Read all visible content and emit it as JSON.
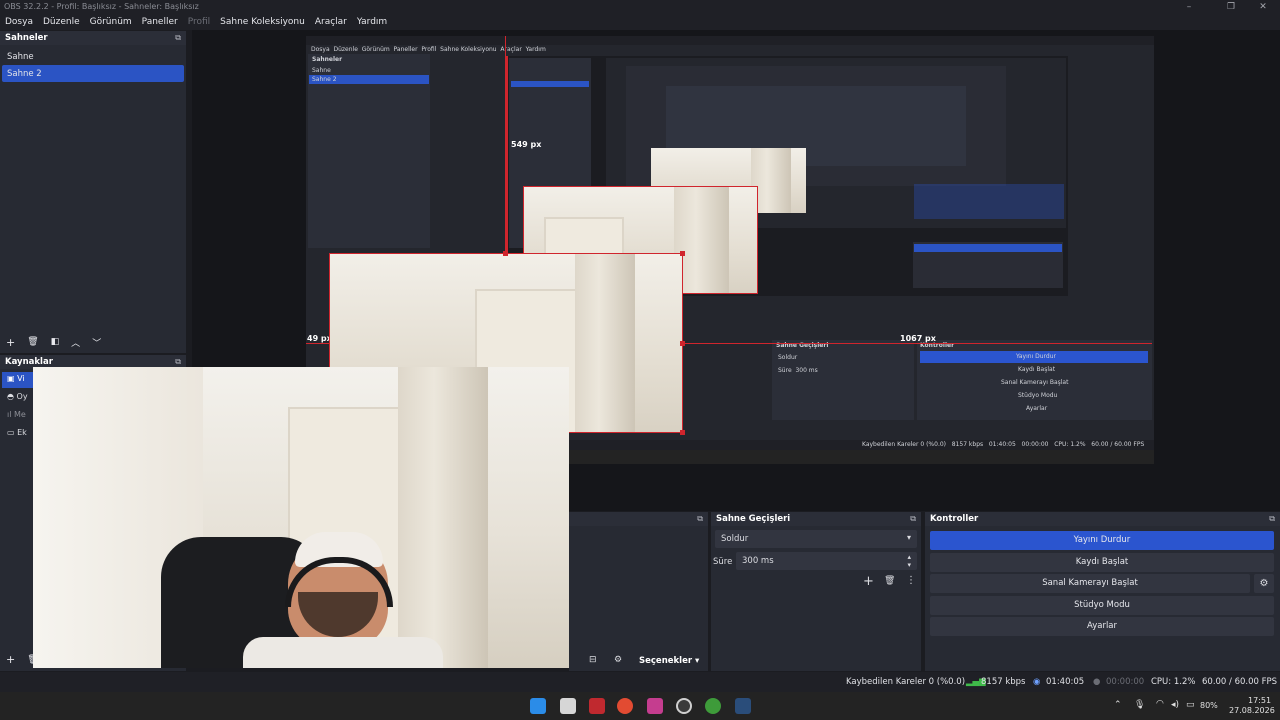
{
  "window": {
    "title": "OBS 32.2.2 - Profil: Başlıksız - Sahneler: Başlıksız"
  },
  "menu": [
    "Dosya",
    "Düzenle",
    "Görünüm",
    "Paneller",
    "Profil",
    "Sahne Koleksiyonu",
    "Araçlar",
    "Yardım"
  ],
  "scenes": {
    "header": "Sahneler",
    "items": [
      "Sahne",
      "Sahne 2"
    ],
    "selected_index": 1
  },
  "sources": {
    "header": "Kaynaklar",
    "items": [
      {
        "label": "Vi",
        "icon": "camera-icon"
      },
      {
        "label": "Oy",
        "icon": "gamepad-icon"
      },
      {
        "label": "Me",
        "icon": "audio-bars-icon"
      },
      {
        "label": "Ek",
        "icon": "monitor-icon"
      }
    ]
  },
  "preview": {
    "measure_top": "549 px",
    "measure_left": "49 px",
    "measure_right": "1067 px"
  },
  "transitions": {
    "header": "Sahne Geçişleri",
    "selected": "Soldur",
    "duration_label": "Süre",
    "duration_value": "300 ms"
  },
  "mixer": {
    "options_label": "Seçenekler"
  },
  "controls": {
    "header": "Kontroller",
    "stop_stream": "Yayını Durdur",
    "start_record": "Kaydı Başlat",
    "start_virtualcam": "Sanal Kamerayı Başlat",
    "studio_mode": "Stüdyo Modu",
    "settings": "Ayarlar"
  },
  "status": {
    "dropped": "Kaybedilen Kareler 0 (%0.0)",
    "bitrate": "8157 kbps",
    "stream_time": "01:40:05",
    "record_time": "00:00:00",
    "cpu": "CPU: 1.2%",
    "fps": "60.00 / 60.00 FPS"
  },
  "taskbar": {
    "battery": "80%",
    "time": "17:51",
    "date": "27.08.2026"
  },
  "colors": {
    "accent": "#2b55cf",
    "selection_red": "#d0252d"
  }
}
